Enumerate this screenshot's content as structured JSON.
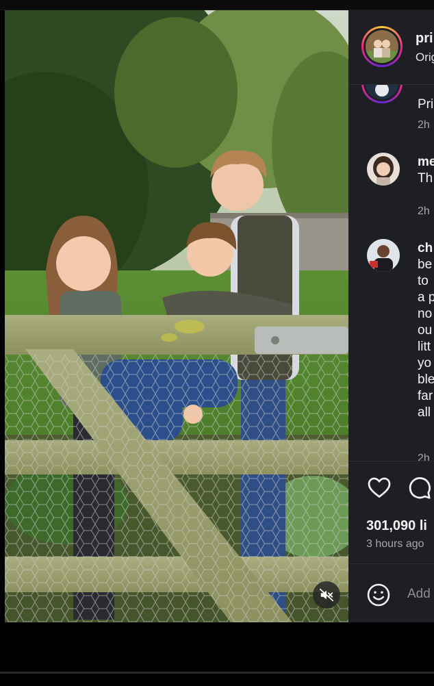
{
  "post": {
    "username": "pri",
    "subtitle": "Orig",
    "media_alt": "Three children smiling behind a wooden farm gate with chicken wire",
    "muted": true
  },
  "comments": [
    {
      "username": "",
      "text": [
        "Pri"
      ],
      "time": "2h",
      "avatar": "princess-avatar"
    },
    {
      "username": "me",
      "text": [
        "Th"
      ],
      "time": "2h",
      "avatar": "woman-dark-hair-avatar"
    },
    {
      "username": "ch",
      "text": [
        "be",
        "to",
        "a p",
        "no",
        "ou",
        "litt",
        "yo",
        "ble",
        "far",
        "all"
      ],
      "time": "2h",
      "avatar": "woman-red-top-avatar"
    }
  ],
  "actions": {
    "likes": "301,090 li",
    "posted": "3 hours ago",
    "add_comment_placeholder": "Add"
  },
  "icons": {
    "like": "heart-icon",
    "comment": "comment-bubble-icon",
    "emoji": "emoji-smiley-icon",
    "mute": "speaker-muted-icon"
  },
  "colors": {
    "panel_bg": "#1e1f24",
    "text_primary": "#f5f5f5",
    "text_secondary": "#a8a8a8",
    "ring_gradient": [
      "#f9ce34",
      "#ee2a7b",
      "#6228d7"
    ]
  }
}
